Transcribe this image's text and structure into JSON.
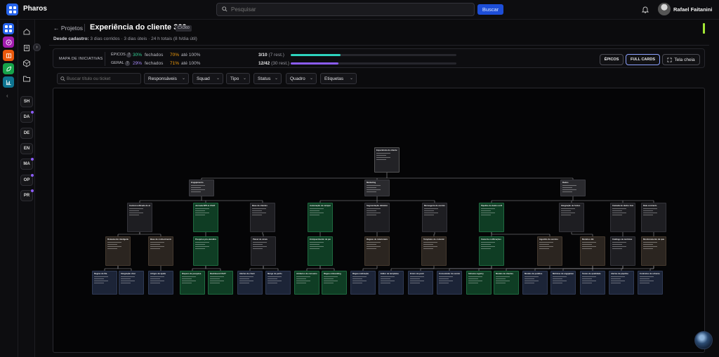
{
  "app": {
    "name": "Pharos"
  },
  "topbar": {
    "search_placeholder": "Pesquisar",
    "search_button": "Buscar",
    "user_name": "Rafael Faitanini"
  },
  "workspaces": [
    {
      "label": "SH",
      "dot": false
    },
    {
      "label": "DA",
      "dot": true
    },
    {
      "label": "DE",
      "dot": false
    },
    {
      "label": "EN",
      "dot": false
    },
    {
      "label": "MA",
      "dot": true
    },
    {
      "label": "OP",
      "dot": true
    },
    {
      "label": "PR",
      "dot": true
    }
  ],
  "rail_colors": [
    "#2563eb",
    "#a21caf",
    "#ea580c",
    "#16a34a",
    "#0e7490"
  ],
  "header": {
    "breadcrumb": "← Projetos",
    "title": "Experiência do cliente 360",
    "code": "CX360",
    "meta_label": "Desde cadastro:",
    "meta_value": "3 dias corridos · 3 dias úteis · 24 h totais (8 h/dia útil)"
  },
  "stats": {
    "panel_title": "MAPA DE INICIATIVAS",
    "epicos": {
      "label": "ÉPICOS",
      "pct_closed": "30%",
      "closed_text": "fechados",
      "pct_100": "70%",
      "to100_text": "até 100%",
      "count": "3/10",
      "rest": "(7 rest.)",
      "progress": 0.3,
      "color": "#2dd4bf"
    },
    "geral": {
      "label": "GERAL",
      "pct_closed": "29%",
      "closed_text": "fechados",
      "pct_100": "71%",
      "to100_text": "até 100%",
      "count": "12/42",
      "rest": "(30 rest.)",
      "progress": 0.29,
      "color": "#8b5cf6"
    },
    "btn_epicos": "ÉPICOS",
    "btn_full": "FULL CARDS",
    "btn_fullscreen": "Tela cheia"
  },
  "filters": {
    "search_placeholder": "Buscar título ou ticket",
    "dropdowns": [
      "Responsáveis",
      "Squad",
      "Tipo",
      "Status",
      "Quadro",
      "Etiquetas"
    ]
  },
  "tree": {
    "root": "Experiência do cliente 360",
    "level1": [
      "Engajamento",
      "Marketing",
      "Dados"
    ],
    "level2": [
      "Central unificada de atendimento",
      "Jornada NPS & CSAT",
      "Base de clientes",
      "Automação de campanhas CRM",
      "Segmentação dinâmica",
      "Mensageria de eventos",
      "Pipeline de dados unificado",
      "Integração de fontes",
      "Camada de dados Gold",
      "Data contracts"
    ],
    "level3": [
      "Roteamento inteligente",
      "Base de conhecimento",
      "Pesquisa pós-atendimento",
      "Painel de sinais",
      "Enriquecimento de perfil",
      "Réguas de relacionamento",
      "Templates de comunicação",
      "Canal de notificações",
      "Ingestão de eventos",
      "Modelos dbt",
      "Catálogo de métricas",
      "Monitoramento de qualidade"
    ],
    "level4": [
      "Regras de fila",
      "Integração chat",
      "Artigos de ajuda",
      "Disparo de pesquisa",
      "Dashboard CSAT",
      "Alertas de churn",
      "Merge de perfis",
      "Atributos de consumo",
      "Régua onboarding",
      "Régua reativação",
      "Editor de templates",
      "Envio via push",
      "Consumidor de eventos",
      "Schema registry",
      "Modelo de clientes",
      "Modelo de pedidos",
      "Métricas de engajamento",
      "Testes de qualidade",
      "Alertas de pipeline",
      "Contratos de schema"
    ]
  }
}
